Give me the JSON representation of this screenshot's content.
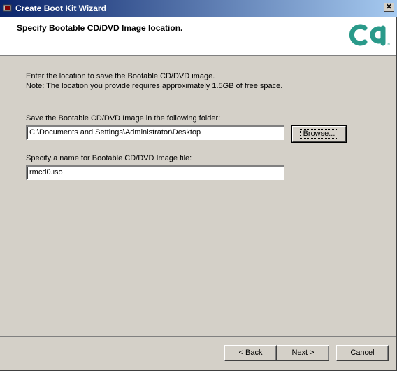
{
  "window": {
    "title": "Create Boot Kit Wizard",
    "close_label": "✕"
  },
  "header": {
    "title": "Specify Bootable CD/DVD Image location."
  },
  "intro": {
    "line1": "Enter the location to save the Bootable CD/DVD image.",
    "line2": "Note: The location you provide requires approximately 1.5GB of free space."
  },
  "folder": {
    "label": "Save the Bootable CD/DVD Image in the following folder:",
    "value": "C:\\Documents and Settings\\Administrator\\Desktop",
    "browse_label": "Browse..."
  },
  "filename": {
    "label": "Specify a name for Bootable CD/DVD Image file:",
    "value": "rmcd0.iso"
  },
  "footer": {
    "back_label": "< Back",
    "next_label": "Next >",
    "cancel_label": "Cancel"
  },
  "colors": {
    "titlebar_start": "#0a246a",
    "titlebar_end": "#a6caf0",
    "dialog_bg": "#d4d0c8",
    "logo_teal": "#2a9a8a"
  }
}
